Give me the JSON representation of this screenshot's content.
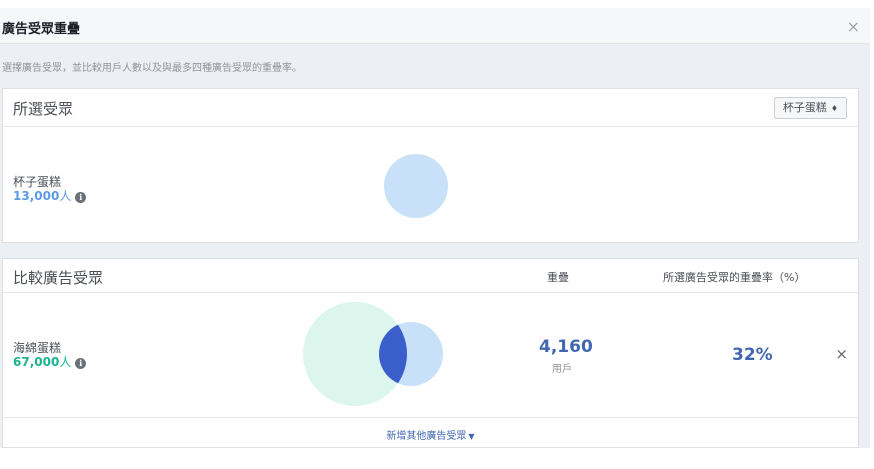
{
  "dialog": {
    "title": "廣告受眾重疊",
    "close_glyph": "×",
    "description": "選擇廣告受眾，並比較用戶人數以及與最多四種廣告受眾的重疊率。"
  },
  "selected_panel": {
    "title": "所選受眾",
    "dropdown_value": "杯子蛋糕",
    "dropdown_caret": "▲▼",
    "audience": {
      "name": "杯子蛋糕",
      "size": "13,000",
      "unit": "人",
      "info_glyph": "i"
    }
  },
  "compare_panel": {
    "title": "比較廣告受眾",
    "col_overlap": "重疊",
    "col_rate": "所選廣告受眾的重疊率（%）",
    "rows": [
      {
        "name": "海綿蛋糕",
        "size": "67,000",
        "unit": "人",
        "info_glyph": "i",
        "overlap_value": "4,160",
        "overlap_unit": "用戶",
        "rate": "32%",
        "remove_glyph": "×"
      }
    ],
    "add_link": "新增其他廣告受眾",
    "add_caret": "▼"
  },
  "colors": {
    "selected_circle": "#c9e1f8",
    "compare_circle": "#dcf6ee",
    "intersection": "#3a5fcb",
    "selected_size_text": "#5b9ae9",
    "compare_size_text": "#18b48f",
    "accent": "#4267b2"
  }
}
